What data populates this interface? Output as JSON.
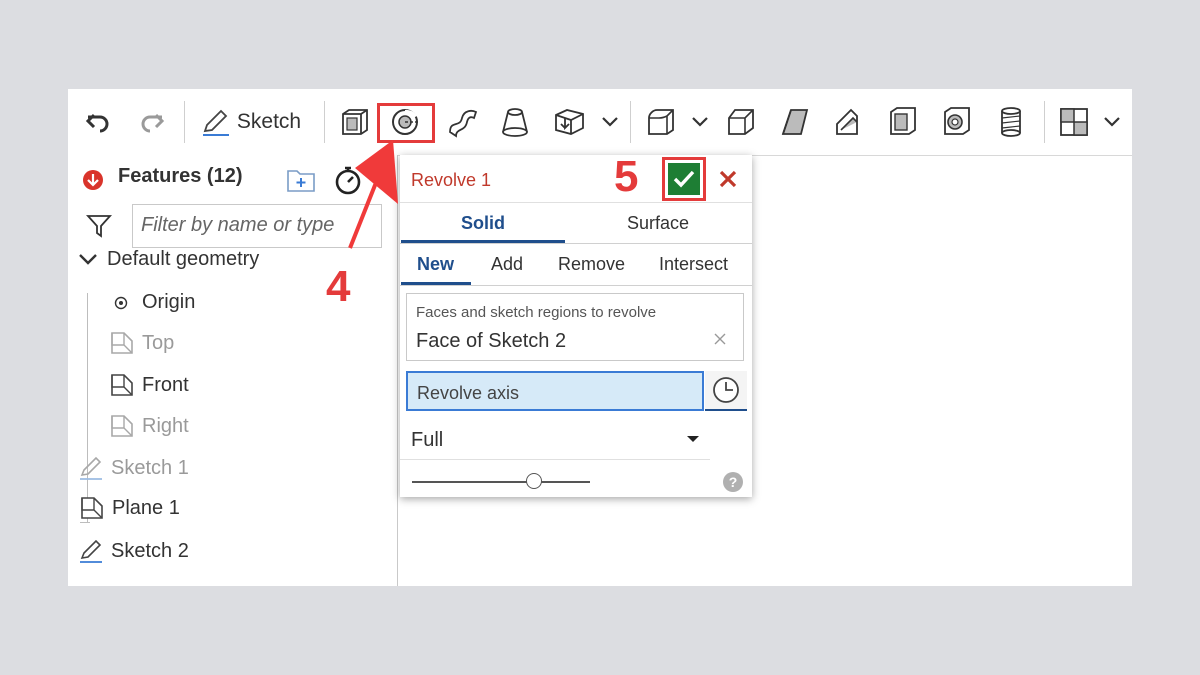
{
  "toolbar": {
    "sketch_label": "Sketch"
  },
  "feature_panel": {
    "title": "Features (12)",
    "filter_placeholder": "Filter by name or type",
    "tree": [
      {
        "label": "Default geometry",
        "muted": false
      },
      {
        "label": "Origin",
        "muted": false
      },
      {
        "label": "Top",
        "muted": true
      },
      {
        "label": "Front",
        "muted": false
      },
      {
        "label": "Right",
        "muted": true
      },
      {
        "label": "Sketch 1",
        "muted": true
      },
      {
        "label": "Plane 1",
        "muted": false
      },
      {
        "label": "Sketch 2",
        "muted": false
      }
    ]
  },
  "dialog": {
    "title": "Revolve 1",
    "tabs": [
      "Solid",
      "Surface"
    ],
    "operations": [
      "New",
      "Add",
      "Remove",
      "Intersect"
    ],
    "faces_label": "Faces and sketch regions to revolve",
    "faces_value": "Face of Sketch 2",
    "axis_label": "Revolve axis",
    "end_type": "Full"
  },
  "annotations": {
    "step_revolve": "4",
    "step_confirm": "5"
  },
  "colors": {
    "accent_blue": "#1f4e8c",
    "title_red": "#c0392b",
    "callout_red": "#e43b3b",
    "confirm_green": "#1e7e34",
    "axis_fill": "#d6eaf8"
  }
}
